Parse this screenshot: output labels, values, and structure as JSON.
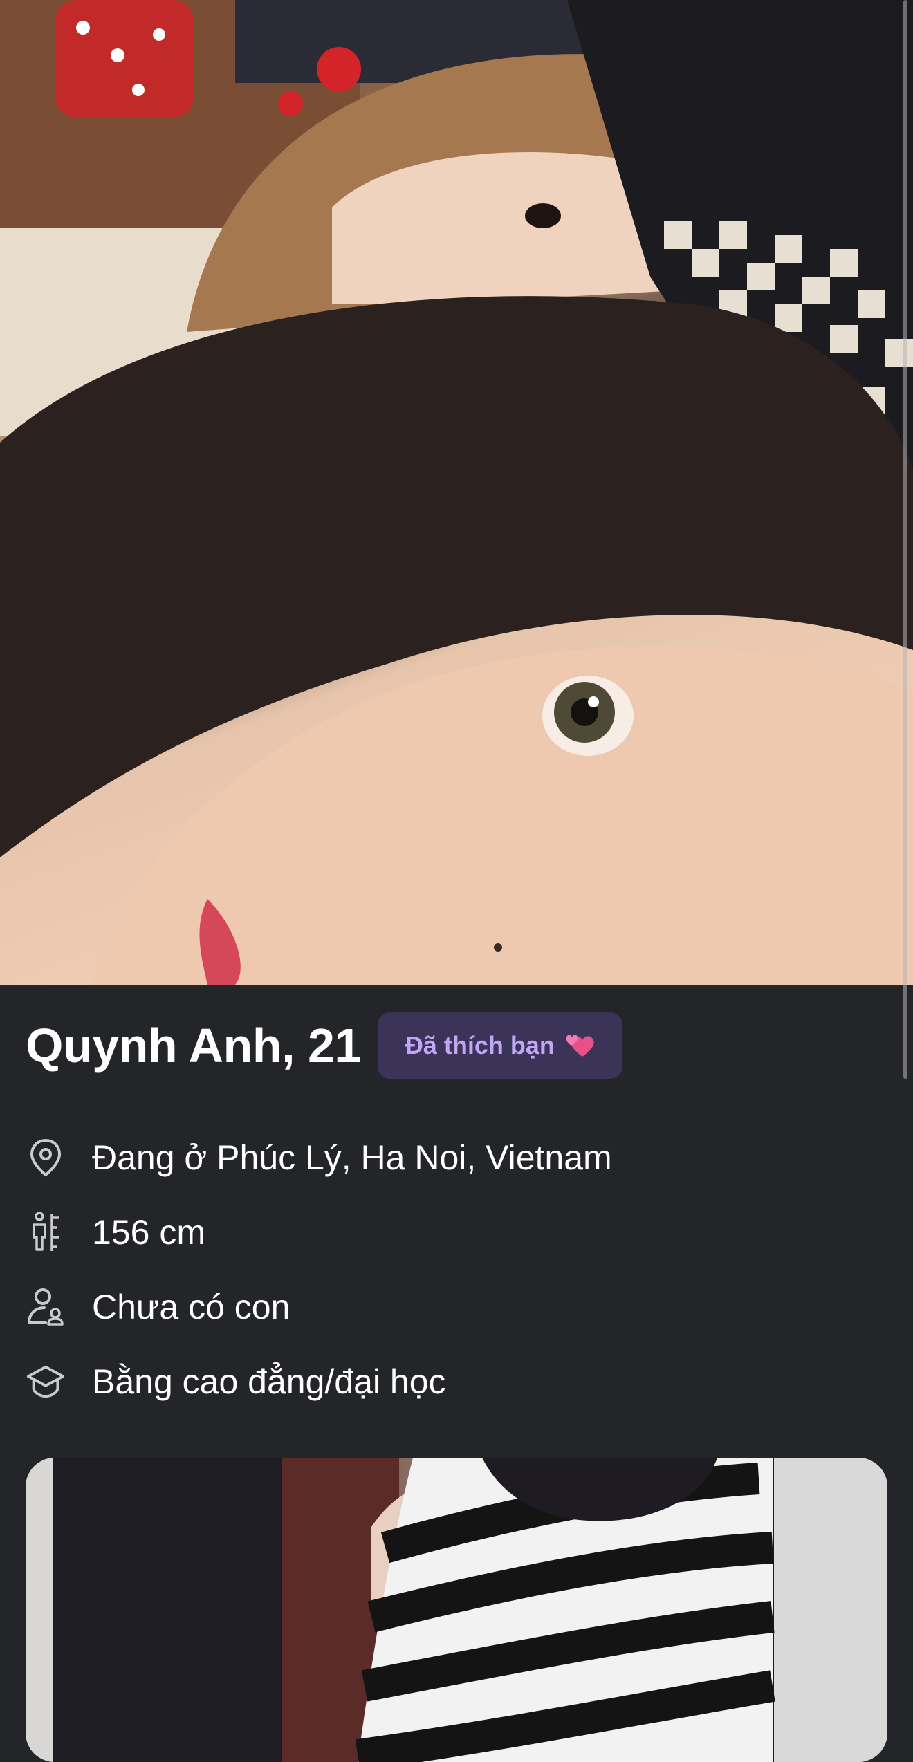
{
  "profile": {
    "name_age": "Quynh Anh, 21",
    "liked_badge": "Đã thích bạn",
    "liked_badge_emoji": "💞"
  },
  "info": [
    {
      "icon": "location-pin-icon",
      "text": "Đang ở Phúc Lý, Ha Noi, Vietnam"
    },
    {
      "icon": "height-ruler-icon",
      "text": "156 cm"
    },
    {
      "icon": "children-icon",
      "text": "Chưa có con"
    },
    {
      "icon": "education-cap-icon",
      "text": "Bằng cao đẳng/đại học"
    }
  ],
  "colors": {
    "background": "#242528",
    "badge_bg": "#3b3458",
    "badge_text": "#c2a6f5"
  }
}
